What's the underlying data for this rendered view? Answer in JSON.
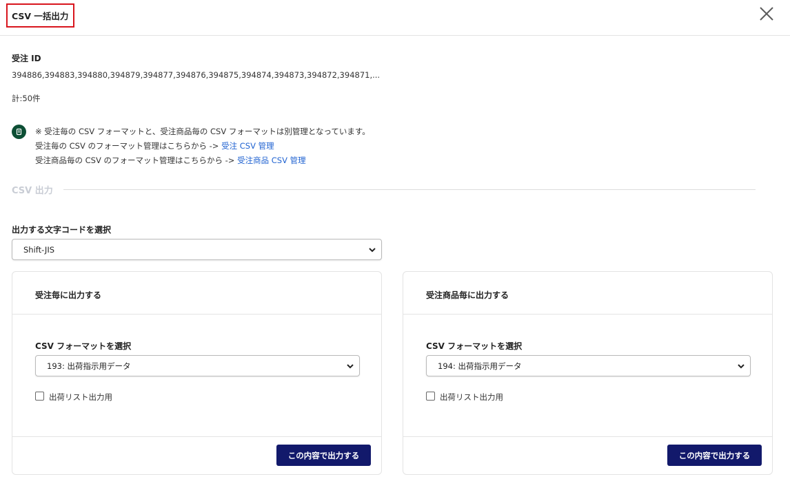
{
  "header": {
    "title": "CSV 一括出力",
    "close_icon": "close-icon"
  },
  "order_ids": {
    "label": "受注 ID",
    "value": "394886,394883,394880,394879,394877,394876,394875,394874,394873,394872,394871,...",
    "total": "計:50件"
  },
  "notice": {
    "icon": "info-icon",
    "line1": "※ 受注毎の CSV フォーマットと、受注商品毎の CSV フォーマットは別管理となっています。",
    "line2_prefix": "受注毎の CSV のフォーマット管理はこちらから ->",
    "line2_link": "受注 CSV 管理",
    "line3_prefix": "受注商品毎の CSV のフォーマット管理はこちらから ->",
    "line3_link": "受注商品 CSV 管理"
  },
  "section": {
    "title": "CSV 出力"
  },
  "encoding": {
    "label": "出力する文字コードを選択",
    "selected": "Shift-JIS"
  },
  "cards": [
    {
      "title": "受注毎に出力する",
      "format_label": "CSV フォーマットを選択",
      "format_selected": "193: 出荷指示用データ",
      "checkbox_label": "出荷リスト出力用",
      "checked": false,
      "submit_label": "この内容で出力する"
    },
    {
      "title": "受注商品毎に出力する",
      "format_label": "CSV フォーマットを選択",
      "format_selected": "194: 出荷指示用データ",
      "checkbox_label": "出荷リスト出力用",
      "checked": false,
      "submit_label": "この内容で出力する"
    }
  ],
  "colors": {
    "highlight_border": "#d8141c",
    "primary_button": "#12196b",
    "link": "#1f62d1",
    "info_icon_bg": "#0d4f35",
    "section_title": "#c9cdd5"
  }
}
